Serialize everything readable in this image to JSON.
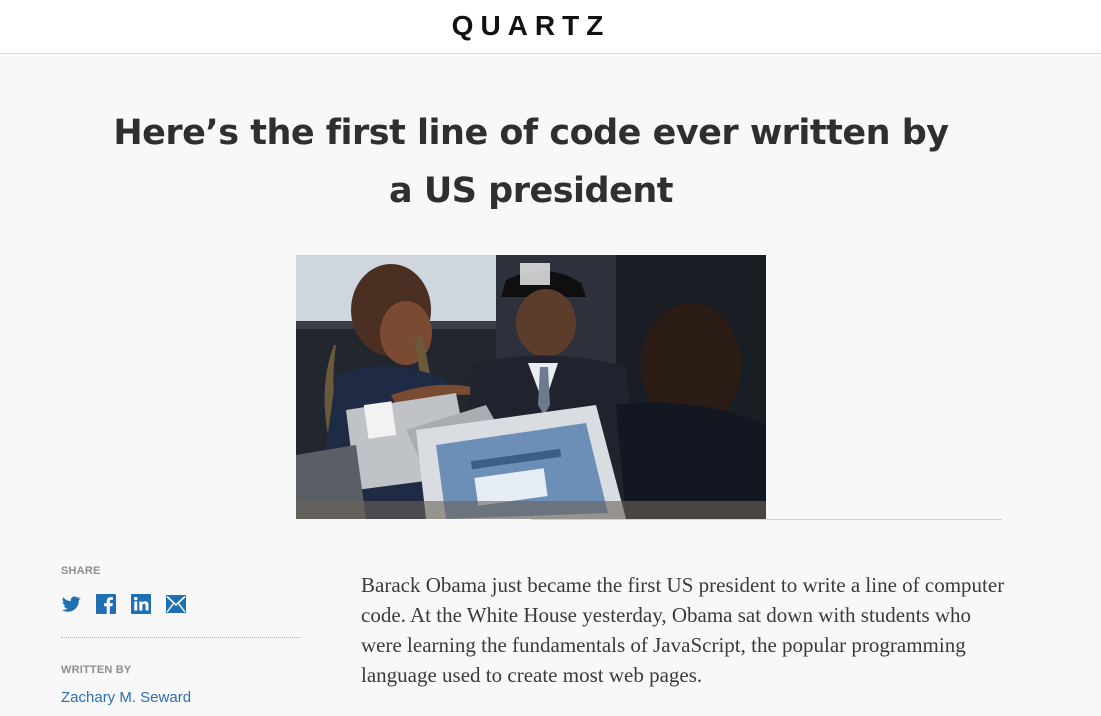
{
  "header": {
    "logo": "QUARTZ"
  },
  "article": {
    "headline": "Here’s the first line of code ever written by a US president",
    "image_alt": "Barack Obama in a black code cap sitting with students at laptops",
    "body": "Barack Obama just became the first US president to write a line of computer code. At the White House yesterday, Obama sat down with students who were learning the fundamentals of JavaScript, the popular programming language used to create most web pages."
  },
  "sidebar": {
    "share_label": "SHARE",
    "share_icons": [
      "twitter-icon",
      "facebook-icon",
      "linkedin-icon",
      "email-icon"
    ],
    "written_by_label": "WRITTEN BY",
    "author": "Zachary M. Seward"
  },
  "colors": {
    "accent": "#2a6fb5",
    "social_icon": "#1f6fb2",
    "headline": "#2f2f2f",
    "background": "#f8f8f8"
  }
}
